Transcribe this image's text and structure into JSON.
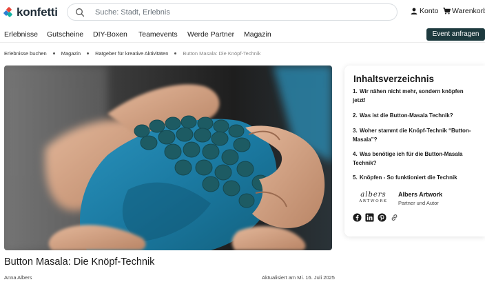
{
  "header": {
    "logo_text": "konfetti",
    "search_placeholder": "Suche: Stadt, Erlebnis",
    "account_label": "Konto",
    "cart_label": "Warenkorb"
  },
  "nav": {
    "items": [
      {
        "label": "Erlebnisse"
      },
      {
        "label": "Gutscheine"
      },
      {
        "label": "DIY-Boxen"
      },
      {
        "label": "Teamevents"
      },
      {
        "label": "Werde Partner"
      },
      {
        "label": "Magazin"
      }
    ],
    "cta_label": "Event anfragen"
  },
  "breadcrumb": {
    "items": [
      {
        "label": "Erlebnisse buchen"
      },
      {
        "label": "Magazin"
      },
      {
        "label": "Ratgeber für kreative Aktivitäten"
      },
      {
        "label": "Button Masala: Die Knöpf-Technik"
      }
    ]
  },
  "article": {
    "title": "Button Masala: Die Knöpf-Technik",
    "author": "Anna Albers",
    "updated": "Aktualisiert am Mi. 16. Juli 2025",
    "hero_description": "hands-holding-teal-fabric-with-buttons"
  },
  "toc": {
    "title": "Inhaltsverzeichnis",
    "items": [
      {
        "num": "1.",
        "label": "Wir nähen nicht mehr, sondern knöpfen jetzt!"
      },
      {
        "num": "2.",
        "label": "Was ist die Button-Masala Technik?"
      },
      {
        "num": "3.",
        "label": "Woher stammt die Knöpf-Technik “Button-Masala”?"
      },
      {
        "num": "4.",
        "label": "Was benötige ich für die Button-Masala Technik?"
      },
      {
        "num": "5.",
        "label": "Knöpfen - So funktioniert die Technik"
      }
    ]
  },
  "author_card": {
    "logo_big": "albers",
    "logo_small": "ARTWORK",
    "name": "Albers Artwork",
    "role": "Partner und Autor",
    "social_icons": [
      "facebook-icon",
      "linkedin-icon",
      "pinterest-icon",
      "link-icon"
    ]
  },
  "colors": {
    "cta_bg": "#1d3a3e",
    "fabric": "#1d7fa6",
    "buttons": "#1d5b63"
  }
}
